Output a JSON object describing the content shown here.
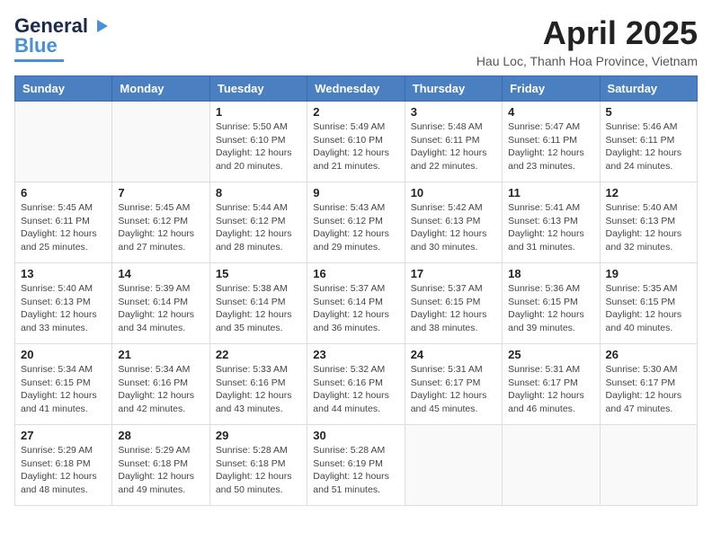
{
  "logo": {
    "line1": "General",
    "line2": "Blue"
  },
  "title": "April 2025",
  "subtitle": "Hau Loc, Thanh Hoa Province, Vietnam",
  "days_of_week": [
    "Sunday",
    "Monday",
    "Tuesday",
    "Wednesday",
    "Thursday",
    "Friday",
    "Saturday"
  ],
  "weeks": [
    [
      {
        "day": "",
        "sunrise": "",
        "sunset": "",
        "daylight": ""
      },
      {
        "day": "",
        "sunrise": "",
        "sunset": "",
        "daylight": ""
      },
      {
        "day": "1",
        "sunrise": "Sunrise: 5:50 AM",
        "sunset": "Sunset: 6:10 PM",
        "daylight": "Daylight: 12 hours and 20 minutes."
      },
      {
        "day": "2",
        "sunrise": "Sunrise: 5:49 AM",
        "sunset": "Sunset: 6:10 PM",
        "daylight": "Daylight: 12 hours and 21 minutes."
      },
      {
        "day": "3",
        "sunrise": "Sunrise: 5:48 AM",
        "sunset": "Sunset: 6:11 PM",
        "daylight": "Daylight: 12 hours and 22 minutes."
      },
      {
        "day": "4",
        "sunrise": "Sunrise: 5:47 AM",
        "sunset": "Sunset: 6:11 PM",
        "daylight": "Daylight: 12 hours and 23 minutes."
      },
      {
        "day": "5",
        "sunrise": "Sunrise: 5:46 AM",
        "sunset": "Sunset: 6:11 PM",
        "daylight": "Daylight: 12 hours and 24 minutes."
      }
    ],
    [
      {
        "day": "6",
        "sunrise": "Sunrise: 5:45 AM",
        "sunset": "Sunset: 6:11 PM",
        "daylight": "Daylight: 12 hours and 25 minutes."
      },
      {
        "day": "7",
        "sunrise": "Sunrise: 5:45 AM",
        "sunset": "Sunset: 6:12 PM",
        "daylight": "Daylight: 12 hours and 27 minutes."
      },
      {
        "day": "8",
        "sunrise": "Sunrise: 5:44 AM",
        "sunset": "Sunset: 6:12 PM",
        "daylight": "Daylight: 12 hours and 28 minutes."
      },
      {
        "day": "9",
        "sunrise": "Sunrise: 5:43 AM",
        "sunset": "Sunset: 6:12 PM",
        "daylight": "Daylight: 12 hours and 29 minutes."
      },
      {
        "day": "10",
        "sunrise": "Sunrise: 5:42 AM",
        "sunset": "Sunset: 6:13 PM",
        "daylight": "Daylight: 12 hours and 30 minutes."
      },
      {
        "day": "11",
        "sunrise": "Sunrise: 5:41 AM",
        "sunset": "Sunset: 6:13 PM",
        "daylight": "Daylight: 12 hours and 31 minutes."
      },
      {
        "day": "12",
        "sunrise": "Sunrise: 5:40 AM",
        "sunset": "Sunset: 6:13 PM",
        "daylight": "Daylight: 12 hours and 32 minutes."
      }
    ],
    [
      {
        "day": "13",
        "sunrise": "Sunrise: 5:40 AM",
        "sunset": "Sunset: 6:13 PM",
        "daylight": "Daylight: 12 hours and 33 minutes."
      },
      {
        "day": "14",
        "sunrise": "Sunrise: 5:39 AM",
        "sunset": "Sunset: 6:14 PM",
        "daylight": "Daylight: 12 hours and 34 minutes."
      },
      {
        "day": "15",
        "sunrise": "Sunrise: 5:38 AM",
        "sunset": "Sunset: 6:14 PM",
        "daylight": "Daylight: 12 hours and 35 minutes."
      },
      {
        "day": "16",
        "sunrise": "Sunrise: 5:37 AM",
        "sunset": "Sunset: 6:14 PM",
        "daylight": "Daylight: 12 hours and 36 minutes."
      },
      {
        "day": "17",
        "sunrise": "Sunrise: 5:37 AM",
        "sunset": "Sunset: 6:15 PM",
        "daylight": "Daylight: 12 hours and 38 minutes."
      },
      {
        "day": "18",
        "sunrise": "Sunrise: 5:36 AM",
        "sunset": "Sunset: 6:15 PM",
        "daylight": "Daylight: 12 hours and 39 minutes."
      },
      {
        "day": "19",
        "sunrise": "Sunrise: 5:35 AM",
        "sunset": "Sunset: 6:15 PM",
        "daylight": "Daylight: 12 hours and 40 minutes."
      }
    ],
    [
      {
        "day": "20",
        "sunrise": "Sunrise: 5:34 AM",
        "sunset": "Sunset: 6:15 PM",
        "daylight": "Daylight: 12 hours and 41 minutes."
      },
      {
        "day": "21",
        "sunrise": "Sunrise: 5:34 AM",
        "sunset": "Sunset: 6:16 PM",
        "daylight": "Daylight: 12 hours and 42 minutes."
      },
      {
        "day": "22",
        "sunrise": "Sunrise: 5:33 AM",
        "sunset": "Sunset: 6:16 PM",
        "daylight": "Daylight: 12 hours and 43 minutes."
      },
      {
        "day": "23",
        "sunrise": "Sunrise: 5:32 AM",
        "sunset": "Sunset: 6:16 PM",
        "daylight": "Daylight: 12 hours and 44 minutes."
      },
      {
        "day": "24",
        "sunrise": "Sunrise: 5:31 AM",
        "sunset": "Sunset: 6:17 PM",
        "daylight": "Daylight: 12 hours and 45 minutes."
      },
      {
        "day": "25",
        "sunrise": "Sunrise: 5:31 AM",
        "sunset": "Sunset: 6:17 PM",
        "daylight": "Daylight: 12 hours and 46 minutes."
      },
      {
        "day": "26",
        "sunrise": "Sunrise: 5:30 AM",
        "sunset": "Sunset: 6:17 PM",
        "daylight": "Daylight: 12 hours and 47 minutes."
      }
    ],
    [
      {
        "day": "27",
        "sunrise": "Sunrise: 5:29 AM",
        "sunset": "Sunset: 6:18 PM",
        "daylight": "Daylight: 12 hours and 48 minutes."
      },
      {
        "day": "28",
        "sunrise": "Sunrise: 5:29 AM",
        "sunset": "Sunset: 6:18 PM",
        "daylight": "Daylight: 12 hours and 49 minutes."
      },
      {
        "day": "29",
        "sunrise": "Sunrise: 5:28 AM",
        "sunset": "Sunset: 6:18 PM",
        "daylight": "Daylight: 12 hours and 50 minutes."
      },
      {
        "day": "30",
        "sunrise": "Sunrise: 5:28 AM",
        "sunset": "Sunset: 6:19 PM",
        "daylight": "Daylight: 12 hours and 51 minutes."
      },
      {
        "day": "",
        "sunrise": "",
        "sunset": "",
        "daylight": ""
      },
      {
        "day": "",
        "sunrise": "",
        "sunset": "",
        "daylight": ""
      },
      {
        "day": "",
        "sunrise": "",
        "sunset": "",
        "daylight": ""
      }
    ]
  ]
}
